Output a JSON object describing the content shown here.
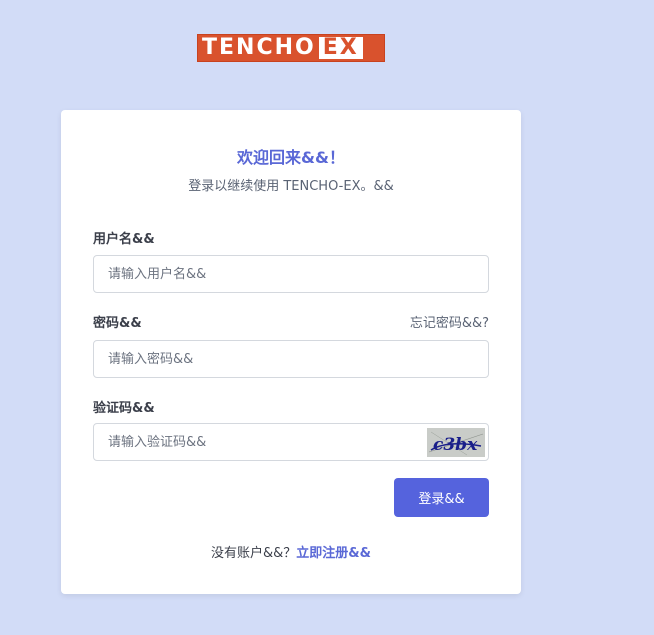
{
  "logo": {
    "text_main": "TENCHO",
    "text_accent": "EX",
    "alt": "TENCHO-EX"
  },
  "login": {
    "title": "欢迎回来&&！",
    "subtitle": "登录以继续使用 TENCHO-EX。&&",
    "username_label": "用户名&&",
    "username_placeholder": "请输入用户名&&",
    "password_label": "密码&&",
    "forgot_link": "忘记密码&&?",
    "password_placeholder": "请输入密码&&",
    "captcha_label": "验证码&&",
    "captcha_placeholder": "请输入验证码&&",
    "captcha_text": "c3bx",
    "submit_label": "登录&&",
    "no_account_text": "没有账户&&？",
    "register_link": "立即注册&&"
  },
  "colors": {
    "background": "#d2dcf7",
    "brand_orange": "#d9522d",
    "accent": "#5a68d6",
    "button": "#5563dd"
  }
}
